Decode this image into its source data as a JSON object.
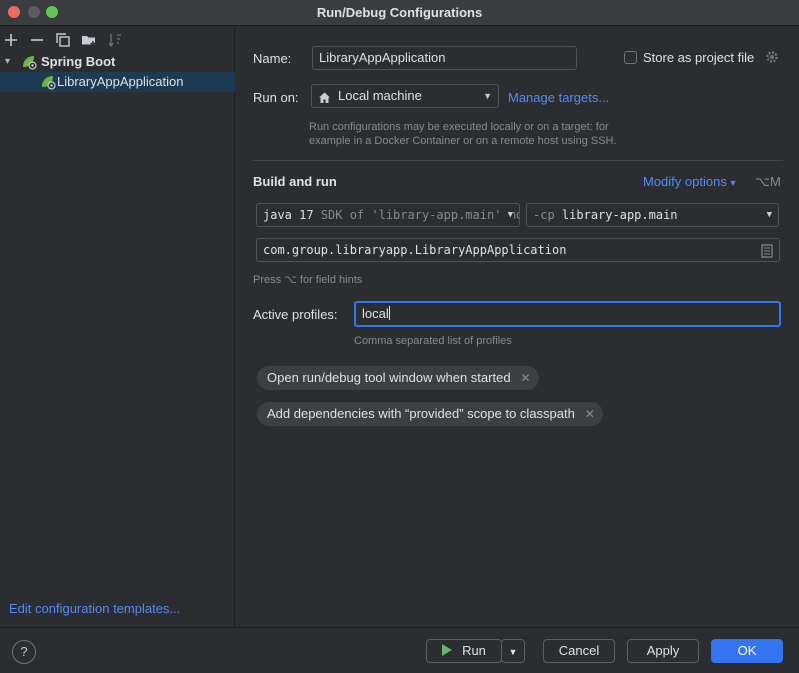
{
  "window": {
    "title": "Run/Debug Configurations"
  },
  "toolbar": {
    "add_icon": "plus-icon",
    "remove_icon": "minus-icon",
    "copy_icon": "copy-icon",
    "folder_icon": "new-folder-icon",
    "sort_icon": "sort-icon"
  },
  "tree": {
    "group_label": "Spring Boot",
    "item_label": "LibraryAppApplication"
  },
  "left_footer": {
    "edit_templates": "Edit configuration templates..."
  },
  "form": {
    "name_label": "Name:",
    "name_value": "LibraryAppApplication",
    "store_label": "Store as project file",
    "run_on_label": "Run on:",
    "run_on_value": "Local machine",
    "manage_targets": "Manage targets...",
    "run_on_hint_1": "Run configurations may be executed locally or on a target: for",
    "run_on_hint_2": "example in a Docker Container or on a remote host using SSH.",
    "build_run_title": "Build and run",
    "modify_options": "Modify options",
    "modify_shortcut": "⌥M",
    "jdk_version": "java 17",
    "jdk_detail": "SDK of 'library-app.main' mo",
    "cp_prefix": "-cp",
    "cp_value": "library-app.main",
    "main_class": "com.group.libraryapp.LibraryAppApplication",
    "field_hint": "Press ⌥ for field hints",
    "profiles_label": "Active profiles:",
    "profiles_value": "local",
    "profiles_hint": "Comma separated list of profiles",
    "chip_1": "Open run/debug tool window when started",
    "chip_2": "Add dependencies with “provided” scope to classpath"
  },
  "buttons": {
    "help": "?",
    "run": "Run",
    "cancel": "Cancel",
    "apply": "Apply",
    "ok": "OK"
  },
  "colors": {
    "accent": "#3574f0",
    "link": "#548af7",
    "run_green": "#5fb865",
    "selection": "#1c3a52"
  }
}
